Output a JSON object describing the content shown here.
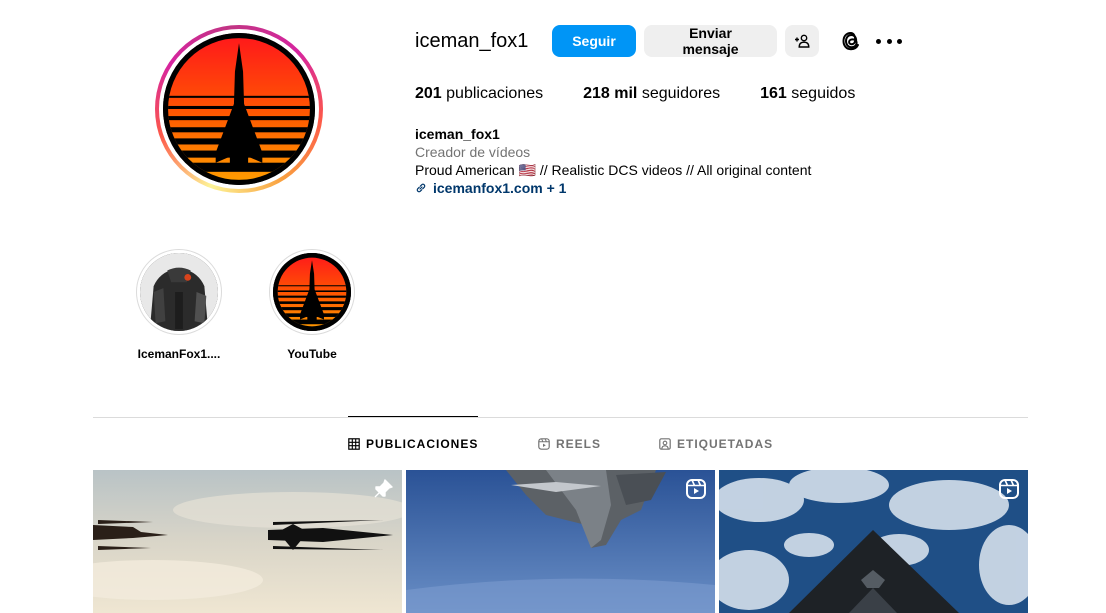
{
  "profile": {
    "username": "iceman_fox1",
    "follow_label": "Seguir",
    "message_label": "Enviar mensaje",
    "posts_count": "201",
    "posts_label": "publicaciones",
    "followers_count": "218 mil",
    "followers_label": "seguidores",
    "following_count": "161",
    "following_label": "seguidos"
  },
  "bio": {
    "name": "iceman_fox1",
    "category": "Creador de vídeos",
    "text": "Proud American 🇺🇸 // Realistic DCS videos // All original content",
    "link": "icemanfox1.com + 1"
  },
  "highlights": [
    {
      "label": "IcemanFox1...."
    },
    {
      "label": "YouTube"
    }
  ],
  "tabs": [
    {
      "label": "PUBLICACIONES",
      "icon": "grid-icon",
      "active": true
    },
    {
      "label": "REELS",
      "icon": "reels-icon",
      "active": false
    },
    {
      "label": "ETIQUETADAS",
      "icon": "tagged-icon",
      "active": false
    }
  ],
  "posts": [
    {
      "badge": "pin-icon"
    },
    {
      "badge": "reel-icon"
    },
    {
      "badge": "reel-icon"
    }
  ],
  "colors": {
    "accent": "#0095f6",
    "link": "#00376b",
    "muted": "#737373",
    "button_bg": "#efefef"
  }
}
